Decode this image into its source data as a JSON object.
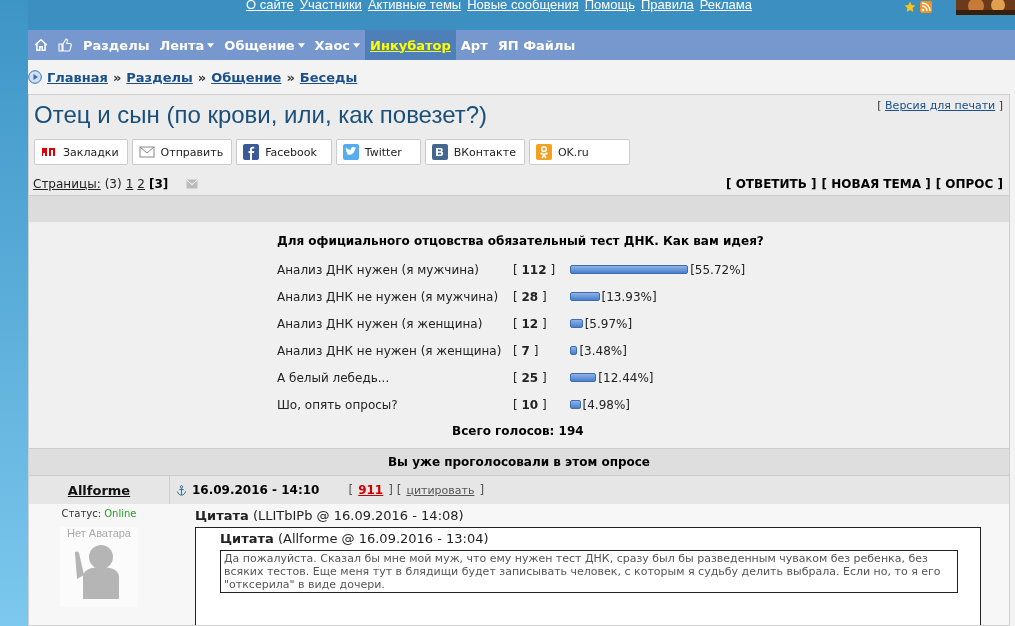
{
  "top_links": [
    "О сайте",
    "Участники",
    "Активные темы",
    "Новые сообщения",
    "Помощь",
    "Правила",
    "Реклама"
  ],
  "nav": [
    {
      "label": "Разделы",
      "dropdown": false,
      "selected": false
    },
    {
      "label": "Лента",
      "dropdown": true,
      "selected": false
    },
    {
      "label": "Общение",
      "dropdown": true,
      "selected": false
    },
    {
      "label": "Хаос",
      "dropdown": true,
      "selected": false
    },
    {
      "label": "Инкубатор",
      "dropdown": false,
      "selected": true
    },
    {
      "label": "Арт",
      "dropdown": false,
      "selected": false
    },
    {
      "label": "ЯП Файлы",
      "dropdown": false,
      "selected": false
    }
  ],
  "breadcrumbs": [
    "Главная",
    "Разделы",
    "Общение",
    "Беседы"
  ],
  "breadcrumb_separator": "»",
  "topic": {
    "title": "Отец и сын (по крови, или, как повезет?)",
    "print_link": "Версия для печати",
    "print_brackets": [
      "[",
      "]"
    ]
  },
  "share": [
    {
      "kind": "yap",
      "label": "Закладки"
    },
    {
      "kind": "mail",
      "label": "Отправить"
    },
    {
      "kind": "facebook",
      "label": "Facebook"
    },
    {
      "kind": "twitter",
      "label": "Twitter"
    },
    {
      "kind": "vk",
      "label": "ВКонтакте"
    },
    {
      "kind": "ok",
      "label": "OK.ru"
    }
  ],
  "pages": {
    "label": "Страницы:",
    "count": "(3)",
    "links": [
      "1",
      "2"
    ],
    "current": "[3]"
  },
  "actions": [
    "[ ОТВЕТИТЬ ]",
    "[ НОВАЯ ТЕМА ]",
    "[ ОПРОС ]"
  ],
  "poll": {
    "question": "Для официального отцовства обязательный тест ДНК. Как вам идея?",
    "options": [
      {
        "label": "Анализ ДНК нужен (я мужчина)",
        "votes": "[ **112** ]",
        "percent": "[55.72%]"
      },
      {
        "label": "Анализ ДНК не нужен (я мужчина)",
        "votes": "[ **28** ]",
        "percent": "[13.93%]"
      },
      {
        "label": "Анализ ДНК нужен (я женщина)",
        "votes": "[ **12** ]",
        "percent": "[5.97%]"
      },
      {
        "label": "Анализ ДНК не нужен (я женщина)",
        "votes": "[ **7** ]",
        "percent": "[3.48%]"
      },
      {
        "label": "А белый лебедь...",
        "votes": "[ **25** ]",
        "percent": "[12.44%]"
      },
      {
        "label": "Шо, опять опросы?",
        "votes": "[ **10** ]",
        "percent": "[4.98%]"
      }
    ],
    "total": "Всего голосов: 194",
    "voted_notice": "Вы уже проголосовали в этом опросе"
  },
  "post": {
    "author": "Allforme",
    "date": "16.09.2016 - 14:10",
    "brackets": [
      "[",
      "] [",
      "]"
    ],
    "rating": "911",
    "quote_link": "цитировать",
    "status_label": "Статус:",
    "status": "Online",
    "avatar_text": "Нет Аватара",
    "quote": {
      "title": "Цитата",
      "source": "(LLITbIPb @ 16.09.2016 - 14:08)",
      "inner": {
        "title": "Цитата",
        "source": "(Allforme @ 16.09.2016 - 13:04)",
        "text": "Да пожалуйста. Сказал бы мне мой муж, что ему нужен тест ДНК, сразу был бы разведенным чуваком без ребенка, без всяких тестов. Еще меня тут в блядищи будет записывать человек, с которым я судьбу делить выбрала. Если но, то я его \"откcерила\" в виде дочери."
      }
    }
  }
}
